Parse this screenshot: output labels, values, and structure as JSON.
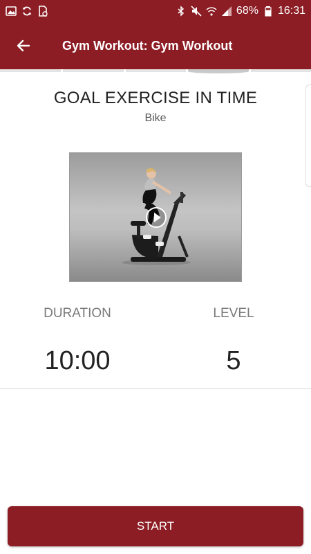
{
  "status_bar": {
    "battery": "68%",
    "time": "16:31",
    "left_icons": [
      "image-icon",
      "sync-icon",
      "file-icon"
    ],
    "right_icons": [
      "bluetooth-icon",
      "mute-icon",
      "wifi-icon",
      "signal-icon",
      "battery-icon"
    ]
  },
  "header": {
    "title": "Gym Workout: Gym Workout",
    "back_icon": "arrow-back-icon"
  },
  "main": {
    "title": "GOAL EXERCISE IN TIME",
    "exercise": "Bike",
    "video_icon": "play-icon",
    "stats": [
      {
        "label": "DURATION",
        "value": "10:00"
      },
      {
        "label": "LEVEL",
        "value": "5"
      }
    ]
  },
  "footer": {
    "start_label": "START"
  },
  "colors": {
    "brand": "#8c1d24",
    "background": "#ffffff"
  }
}
